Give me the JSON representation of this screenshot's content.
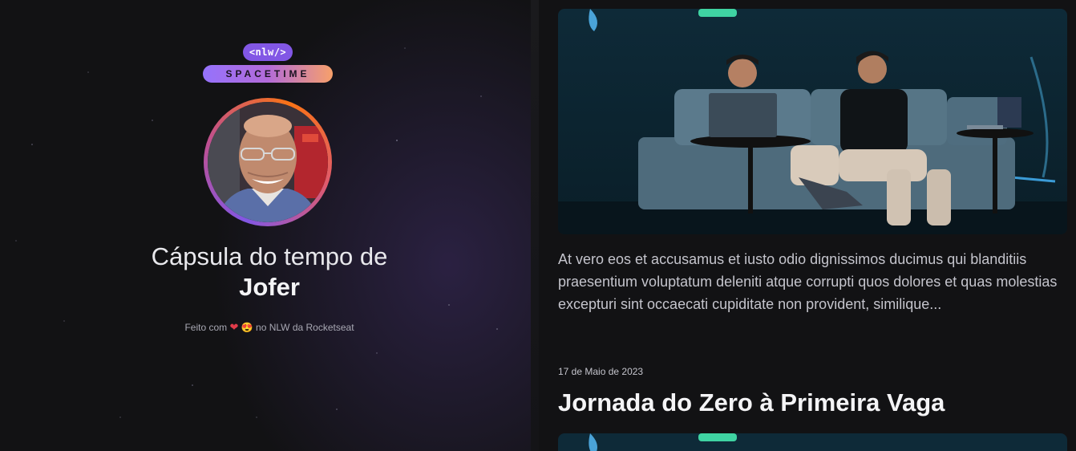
{
  "logo": {
    "tag": "<nlw/>",
    "word": "SPACETIME"
  },
  "hero": {
    "title_prefix": "Cápsula do tempo de",
    "user_name": "Jofer"
  },
  "credit": {
    "before": "Feito com",
    "heart": "❤",
    "emoji": "😍",
    "after": "no NLW da Rocketseat"
  },
  "memories": [
    {
      "excerpt": "At vero eos et accusamus et iusto odio dignissimos ducimus qui blanditiis praesentium voluptatum deleniti atque corrupti quos dolores et quas molestias excepturi sint occaecati cupiditate non provident, similique..."
    },
    {
      "date": "17 de Maio de 2023",
      "title": "Jornada do Zero à Primeira Vaga"
    }
  ],
  "colors": {
    "accent": "#8257e5",
    "background": "#121214",
    "gradient_end": "#f7a06a"
  }
}
